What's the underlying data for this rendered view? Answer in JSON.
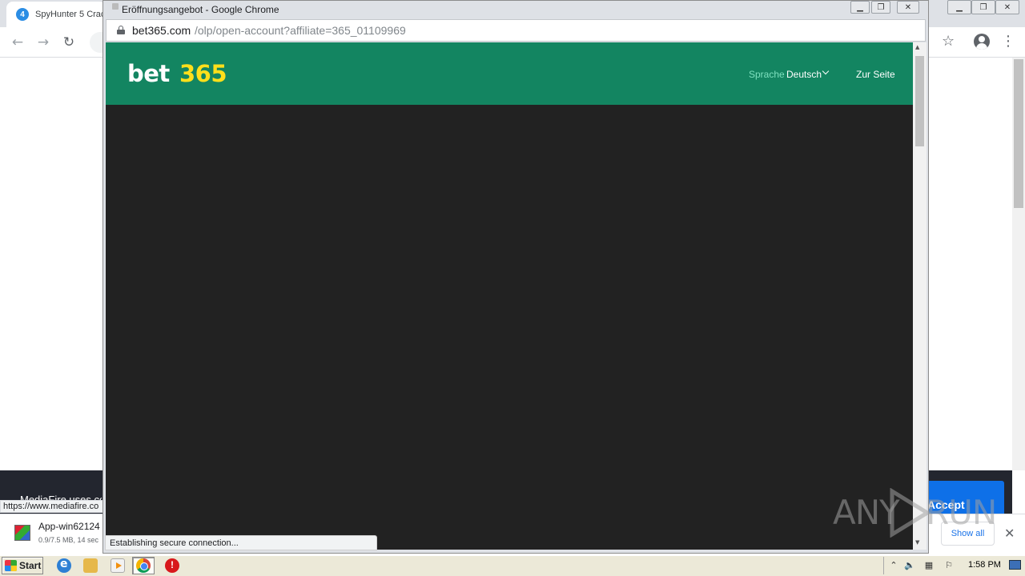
{
  "bg_window": {
    "tab_title": "SpyHunter 5 Crac",
    "tab_favicon": "4",
    "cookie_text": "MediaFire uses co",
    "accept_label": "Accept",
    "status_url": "https://www.mediafire.co",
    "download": {
      "name": "App-win62124",
      "progress": "0.9/7.5 MB, 14 sec"
    },
    "show_all_label": "Show all"
  },
  "popup": {
    "window_title": "Eröffnungsangebot - Google Chrome",
    "url_host": "bet365.com",
    "url_path": "/olp/open-account?affiliate=365_01109969",
    "status_text": "Establishing secure connection...",
    "site": {
      "logo_bet": "bet",
      "logo_365": "365",
      "lang_label": "Sprache",
      "lang_value": "Deutsch",
      "site_link": "Zur Seite"
    }
  },
  "watermark": {
    "any": "ANY",
    "run": "RUN"
  },
  "taskbar": {
    "start_label": "Start",
    "clock": "1:58 PM"
  },
  "colors": {
    "bet365_green": "#138561",
    "bet365_yellow": "#ffdf1b",
    "page_dark": "#222222",
    "accept_blue": "#0e70e8"
  },
  "icons": [
    "back-icon",
    "forward-icon",
    "reload-icon",
    "lock-icon",
    "star-icon",
    "profile-icon",
    "menu-icon",
    "minimize-icon",
    "maximize-icon",
    "close-icon",
    "chevron-down-icon"
  ]
}
